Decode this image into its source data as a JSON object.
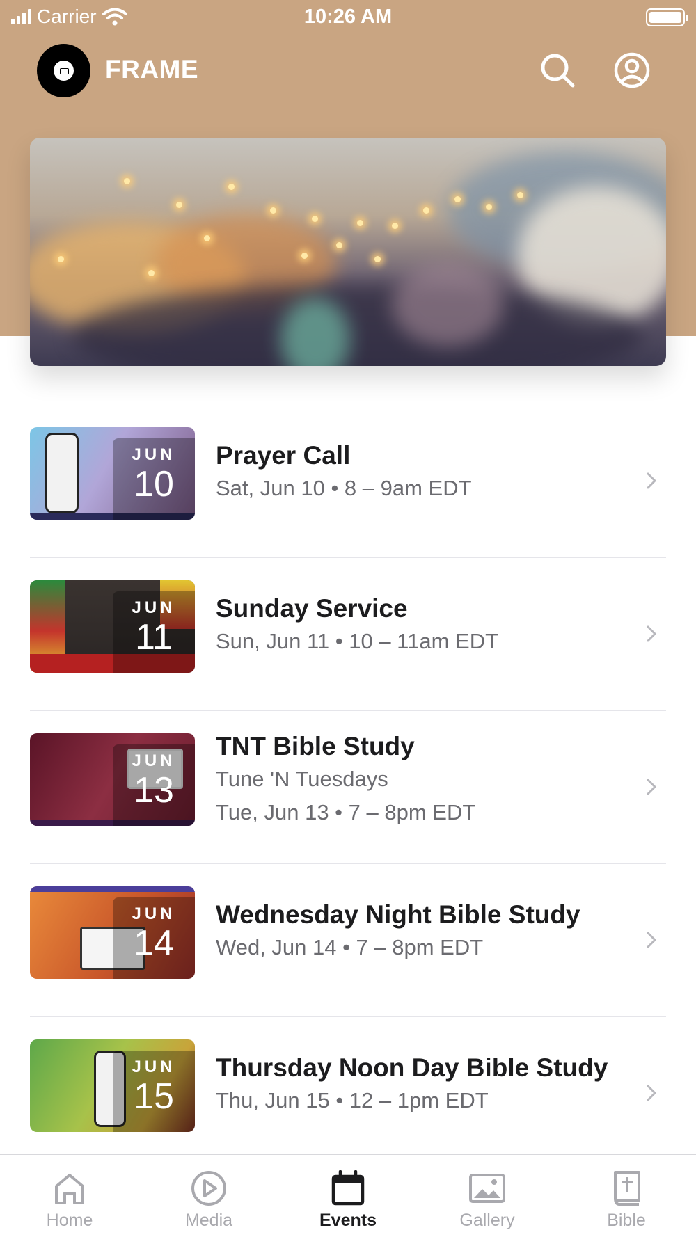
{
  "status_bar": {
    "carrier": "Carrier",
    "time": "10:26 AM"
  },
  "header": {
    "app_name": "FRAME",
    "brand_color": "#c9a582"
  },
  "events": [
    {
      "title": "Prayer Call",
      "lines": [
        "Sat, Jun 10 • 8 – 9am EDT"
      ],
      "month": "JUN",
      "day": "10",
      "theme": "phone-lavender"
    },
    {
      "title": "Sunday Service",
      "lines": [
        "Sun, Jun 11 • 10 – 11am EDT"
      ],
      "month": "JUN",
      "day": "11",
      "theme": "church-dark"
    },
    {
      "title": "TNT Bible Study",
      "lines": [
        "Tune 'N Tuesdays",
        "Tue, Jun 13 • 7 – 8pm EDT"
      ],
      "month": "JUN",
      "day": "13",
      "theme": "maroon-virtual"
    },
    {
      "title": "Wednesday Night Bible Study",
      "lines": [
        "Wed, Jun 14 • 7 – 8pm EDT"
      ],
      "month": "JUN",
      "day": "14",
      "theme": "orange-laptop"
    },
    {
      "title": "Thursday Noon Day Bible Study",
      "lines": [
        "Thu, Jun 15 • 12 – 1pm EDT"
      ],
      "month": "JUN",
      "day": "15",
      "theme": "green-phone"
    }
  ],
  "tabs": [
    {
      "label": "Home",
      "icon": "home-icon",
      "active": false
    },
    {
      "label": "Media",
      "icon": "play-circle-icon",
      "active": false
    },
    {
      "label": "Events",
      "icon": "calendar-icon",
      "active": true
    },
    {
      "label": "Gallery",
      "icon": "image-icon",
      "active": false
    },
    {
      "label": "Bible",
      "icon": "bible-icon",
      "active": false
    }
  ]
}
